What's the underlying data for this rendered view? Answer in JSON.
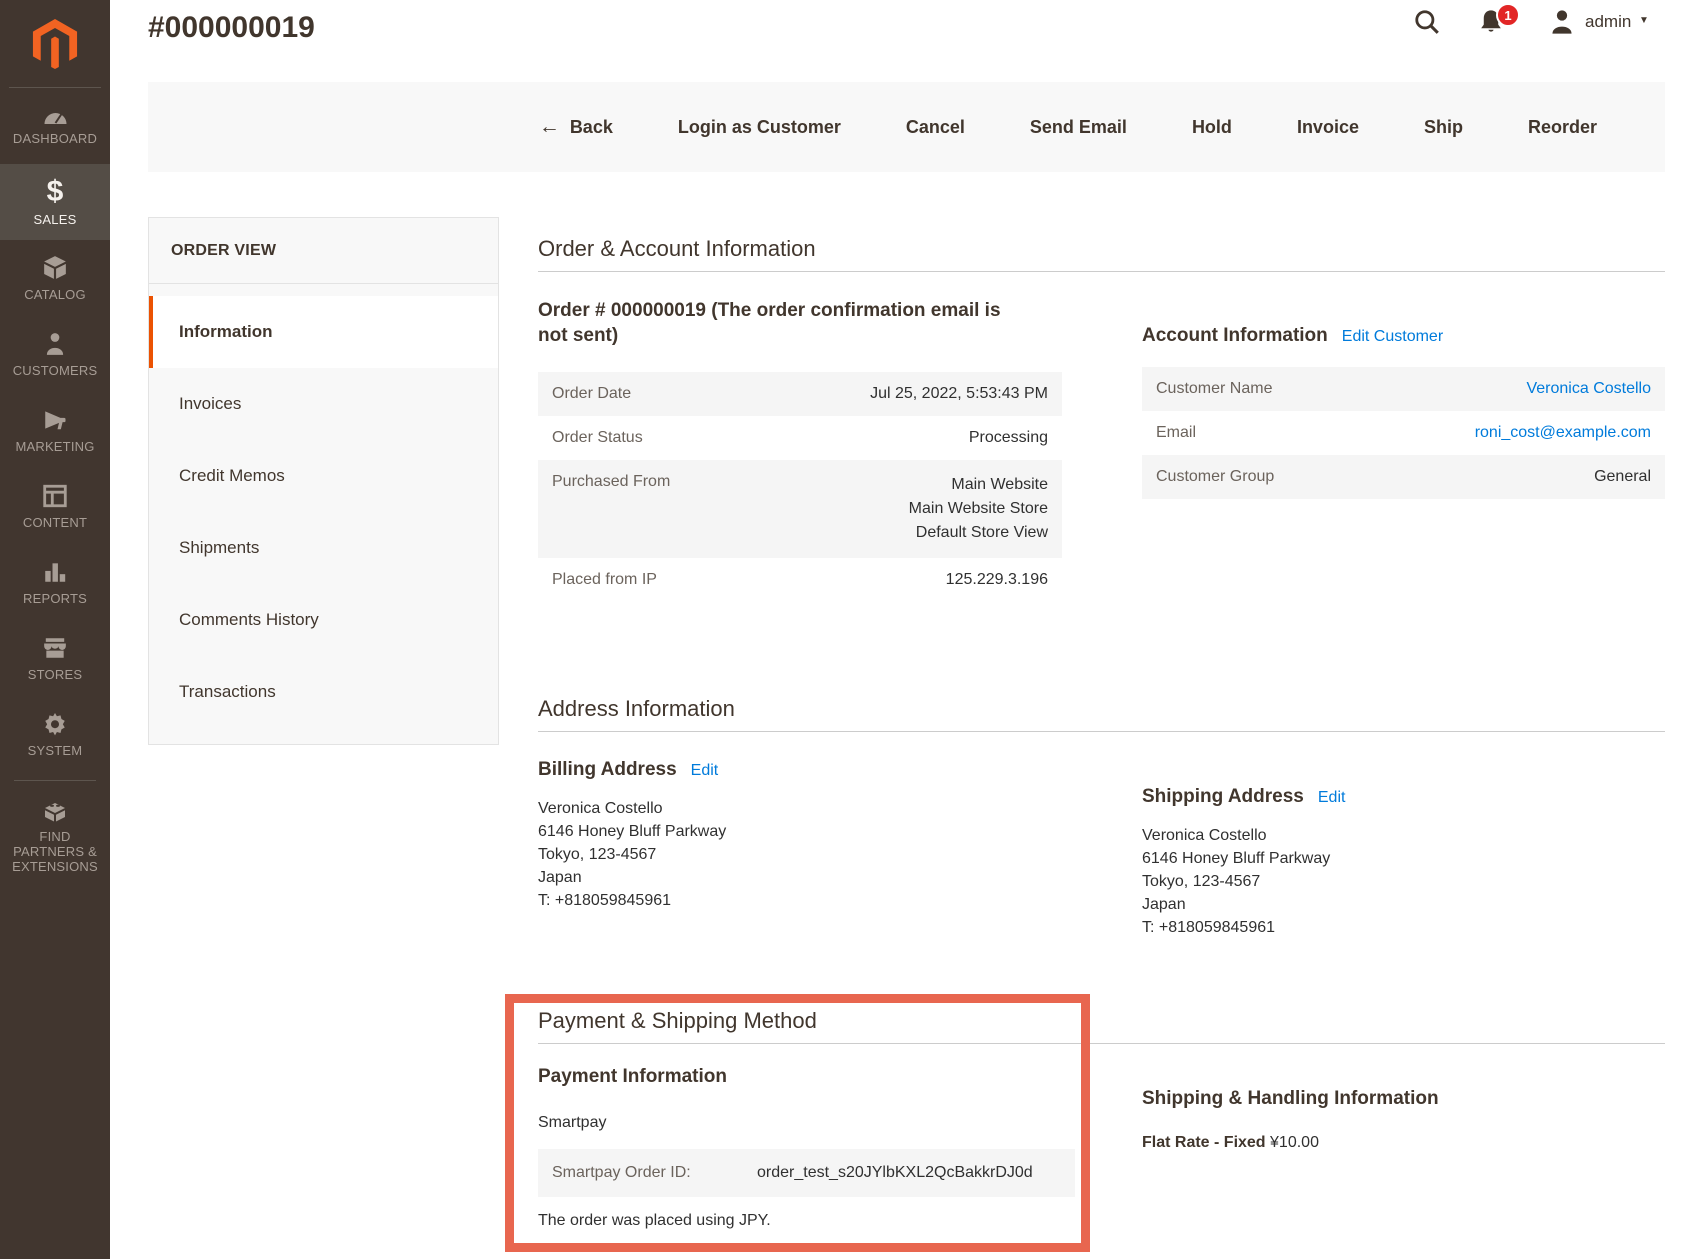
{
  "page": {
    "title": "#000000019"
  },
  "header": {
    "admin_label": "admin",
    "notification_count": "1"
  },
  "icons": {
    "sales_glyph": "$",
    "back_arrow": "←",
    "caret_down": "▼"
  },
  "sidebar": {
    "items": [
      {
        "label": "DASHBOARD"
      },
      {
        "label": "SALES"
      },
      {
        "label": "CATALOG"
      },
      {
        "label": "CUSTOMERS"
      },
      {
        "label": "MARKETING"
      },
      {
        "label": "CONTENT"
      },
      {
        "label": "REPORTS"
      },
      {
        "label": "STORES"
      },
      {
        "label": "SYSTEM"
      },
      {
        "label": "FIND PARTNERS & EXTENSIONS"
      }
    ]
  },
  "toolbar": {
    "back": "Back",
    "buttons": [
      "Login as Customer",
      "Cancel",
      "Send Email",
      "Hold",
      "Invoice",
      "Ship",
      "Reorder"
    ]
  },
  "order_view": {
    "title": "ORDER VIEW",
    "tabs": [
      "Information",
      "Invoices",
      "Credit Memos",
      "Shipments",
      "Comments History",
      "Transactions"
    ]
  },
  "order_account": {
    "heading": "Order & Account Information",
    "order": {
      "heading": "Order # 000000019 (The order confirmation email is not sent)",
      "rows": [
        {
          "label": "Order Date",
          "value": "Jul 25, 2022, 5:53:43 PM"
        },
        {
          "label": "Order Status",
          "value": "Processing"
        },
        {
          "label": "Purchased From",
          "value": "Main Website\nMain Website Store\nDefault Store View"
        },
        {
          "label": "Placed from IP",
          "value": "125.229.3.196"
        }
      ]
    },
    "account": {
      "heading": "Account Information",
      "edit_link": "Edit Customer",
      "rows": [
        {
          "label": "Customer Name",
          "value": "Veronica Costello"
        },
        {
          "label": "Email",
          "value": "roni_cost@example.com"
        },
        {
          "label": "Customer Group",
          "value": "General"
        }
      ]
    }
  },
  "address_info": {
    "heading": "Address Information",
    "billing": {
      "heading": "Billing Address",
      "edit_link": "Edit",
      "address": "Veronica Costello\n6146 Honey Bluff Parkway\nTokyo, 123-4567\nJapan\nT: +818059845961"
    },
    "shipping": {
      "heading": "Shipping Address",
      "edit_link": "Edit",
      "address": "Veronica Costello\n6146 Honey Bluff Parkway\nTokyo, 123-4567\nJapan\nT: +818059845961"
    }
  },
  "payment_shipping": {
    "heading": "Payment & Shipping Method",
    "payment": {
      "heading": "Payment Information",
      "method": "Smartpay",
      "order_id_label": "Smartpay Order ID:",
      "order_id": "order_test_s20JYlbKXL2QcBakkrDJ0d",
      "note": "The order was placed using JPY."
    },
    "shipping": {
      "heading": "Shipping & Handling Information",
      "method": "Flat Rate - Fixed",
      "amount": "¥10.00"
    }
  },
  "colors": {
    "sidebar_bg": "#41362f",
    "accent_orange": "#eb5202",
    "logo_orange": "#f26322",
    "highlight_border": "#e8664f",
    "link_blue": "#007bdb",
    "badge_red": "#e22626"
  }
}
